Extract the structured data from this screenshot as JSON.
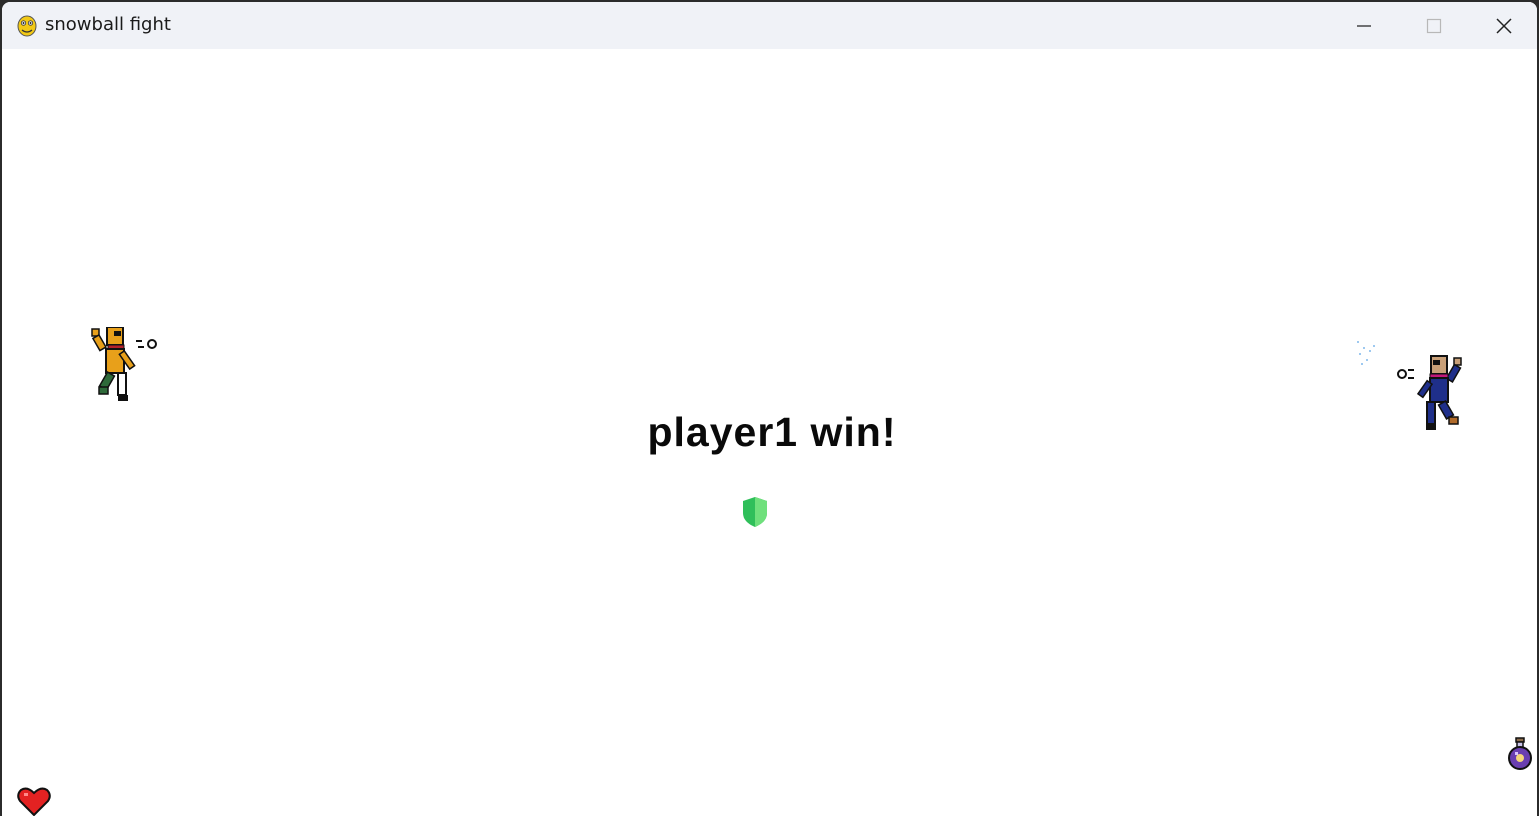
{
  "window": {
    "title": "snowball fight",
    "app_icon": "pygame-snake-icon",
    "controls": [
      "minimize-icon",
      "maximize-icon",
      "close-icon"
    ]
  },
  "game": {
    "result_text": "player1 win!",
    "player1": {
      "icon": "player1-sprite",
      "color": "#e8a01a",
      "scarf": "#b5202a"
    },
    "player2": {
      "icon": "player2-sprite",
      "color": "#1f2f8a",
      "scarf": "#c2187a"
    },
    "shield": {
      "icon": "shield-powerup-icon",
      "colors": [
        "#2fbf5a",
        "#6fe07c"
      ]
    },
    "health": {
      "icon": "heart-icon",
      "color": "#e32222"
    },
    "potion": {
      "icon": "potion-icon",
      "color": "#6a3fb0"
    }
  }
}
